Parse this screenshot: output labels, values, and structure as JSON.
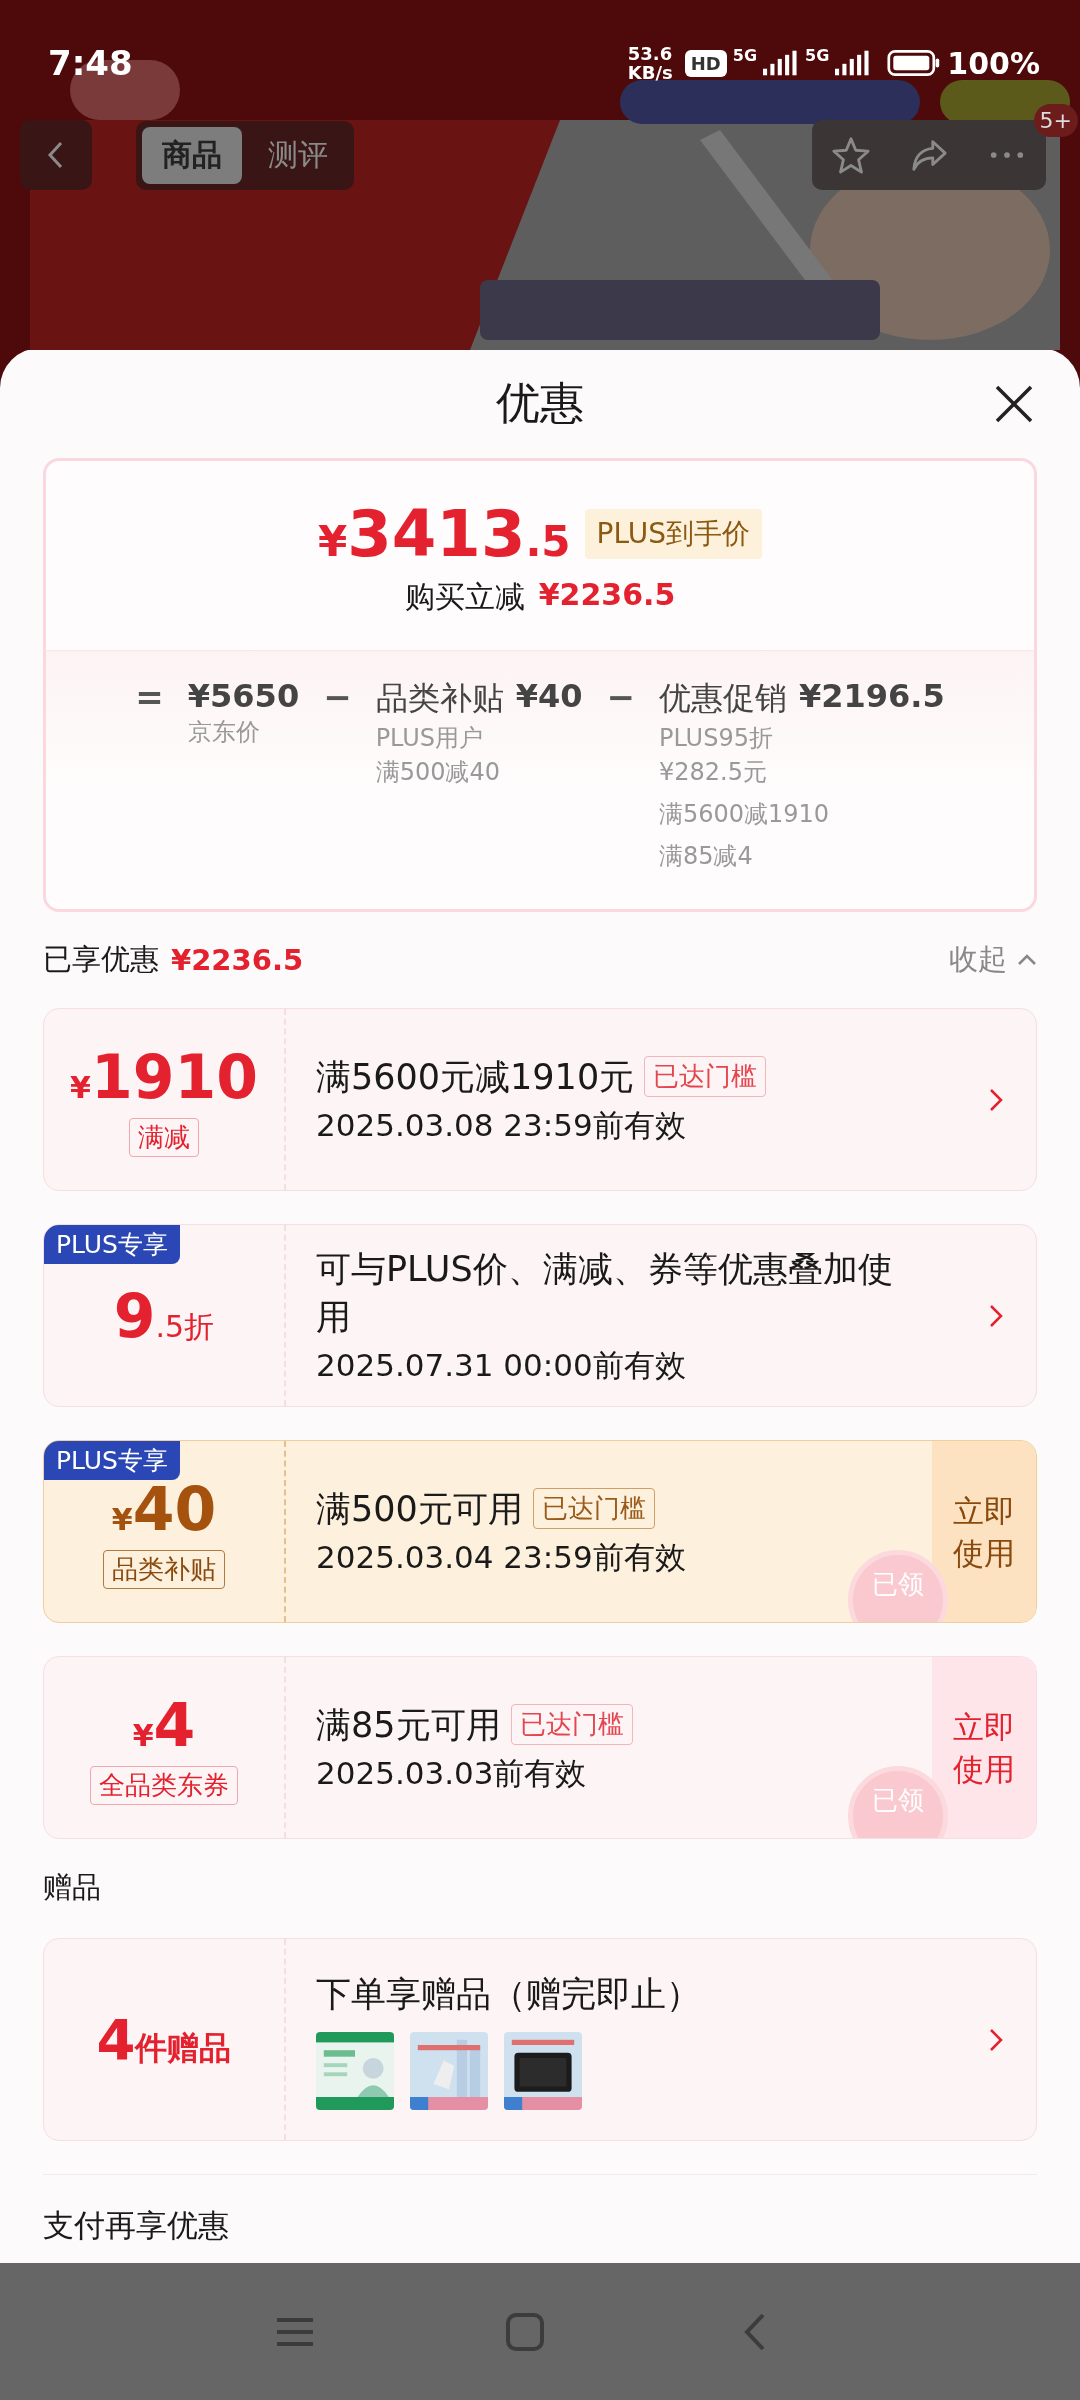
{
  "status_bar": {
    "time": "7:48",
    "speed_value": "53.6",
    "speed_unit": "KB/s",
    "hd": "HD",
    "network_1": "5G",
    "network_2": "5G",
    "battery": "100%"
  },
  "nav": {
    "tabs": [
      {
        "label": "商品",
        "selected": true
      },
      {
        "label": "测评",
        "selected": false
      }
    ],
    "badge": "5+"
  },
  "sheet": {
    "title": "优惠",
    "summary": {
      "currency": "¥",
      "price_int": "3413",
      "price_dec": ".5",
      "tag": "PLUS到手价",
      "saving_label": "购买立减",
      "saving_value": "¥2236.5",
      "breakdown": [
        {
          "operator": "=",
          "amount": "¥5650",
          "notes": [
            "京东价"
          ]
        },
        {
          "operator": "−",
          "label": "品类补贴",
          "amount": "¥40",
          "notes": [
            "PLUS用户",
            "满500减40"
          ]
        },
        {
          "operator": "−",
          "label": "优惠促销",
          "amount": "¥2196.5",
          "notes": [
            "PLUS95折",
            "¥282.5元",
            "满5600减1910",
            "满85减4"
          ]
        }
      ]
    },
    "enjoyed": {
      "label": "已享优惠",
      "value": "¥2236.5",
      "toggle": "收起",
      "expanded": true
    },
    "coupons": [
      {
        "kind": "promo",
        "currency": "¥",
        "amount": "1910",
        "badge": "满减",
        "title": "满5600元减1910元",
        "tag": "已达门槛",
        "validity": "2025.03.08 23:59前有效"
      },
      {
        "kind": "promo",
        "plus_tag": "PLUS专享",
        "amount": "9",
        "suffix": ".5折",
        "title": "可与PLUS价、满减、券等优惠叠加使用",
        "validity": "2025.07.31 00:00前有效"
      },
      {
        "kind": "plus_coupon",
        "plus_tag": "PLUS专享",
        "currency": "¥",
        "amount": "40",
        "badge": "品类补贴",
        "title": "满500元可用",
        "tag": "已达门槛",
        "validity": "2025.03.04 23:59前有效",
        "action": "立即使用",
        "stamp": "已领"
      },
      {
        "kind": "coupon",
        "currency": "¥",
        "amount": "4",
        "badge": "全品类东券",
        "title": "满85元可用",
        "tag": "已达门槛",
        "validity": "2025.03.03前有效",
        "action": "立即使用",
        "stamp": "已领"
      }
    ],
    "gifts": {
      "heading": "赠品",
      "count": "4",
      "count_suffix": "件赠品",
      "title": "下单享赠品（赠完即止）"
    },
    "pay_heading": "支付再享优惠"
  }
}
